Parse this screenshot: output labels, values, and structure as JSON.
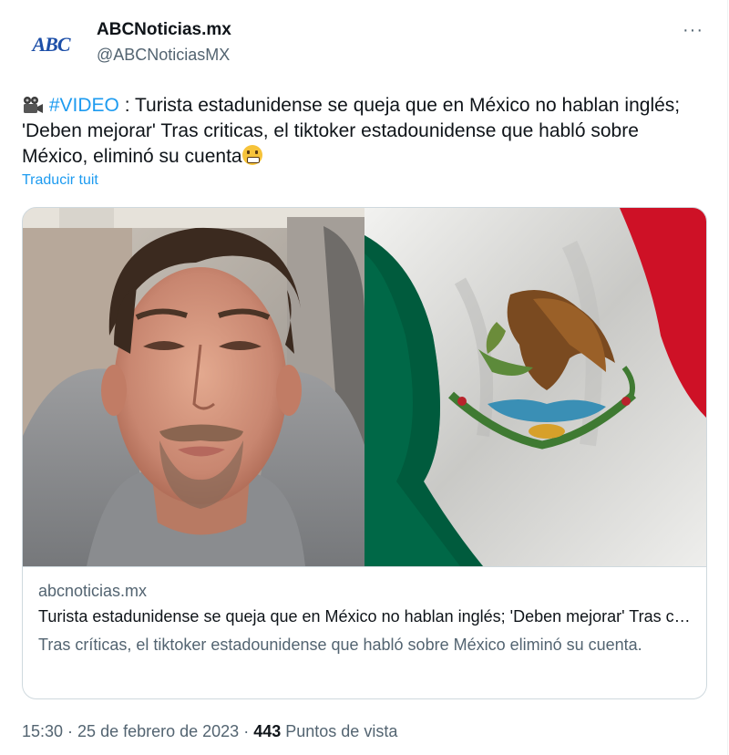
{
  "account": {
    "logo_text": "ABC",
    "name": "ABCNoticias.mx",
    "handle": "@ABCNoticiasMX",
    "more_label": "···"
  },
  "tweet": {
    "hashtag": "#VIDEO",
    "text": " : Turista estadunidense se queja que en México no hablan inglés; 'Deben mejorar' Tras criticas, el tiktoker estadounidense que habló sobre México, eliminó su cuenta",
    "translate_label": "Traducir tuit"
  },
  "card": {
    "domain": "abcnoticias.mx",
    "title": "Turista estadunidense se queja que en México no hablan inglés; 'Deben mejorar' Tras críticas",
    "description": "Tras críticas, el tiktoker estadounidense que habló sobre México eliminó su cuenta."
  },
  "footer": {
    "time": "15:30",
    "sep1": " · ",
    "date": "25 de febrero de 2023",
    "sep2": " · ",
    "views": "443",
    "views_label": " Puntos de vista"
  },
  "colors": {
    "link": "#1d9bf0",
    "secondary_text": "#536471",
    "border": "#cfd9de",
    "flag_green": "#006847",
    "flag_red": "#ce1126"
  }
}
